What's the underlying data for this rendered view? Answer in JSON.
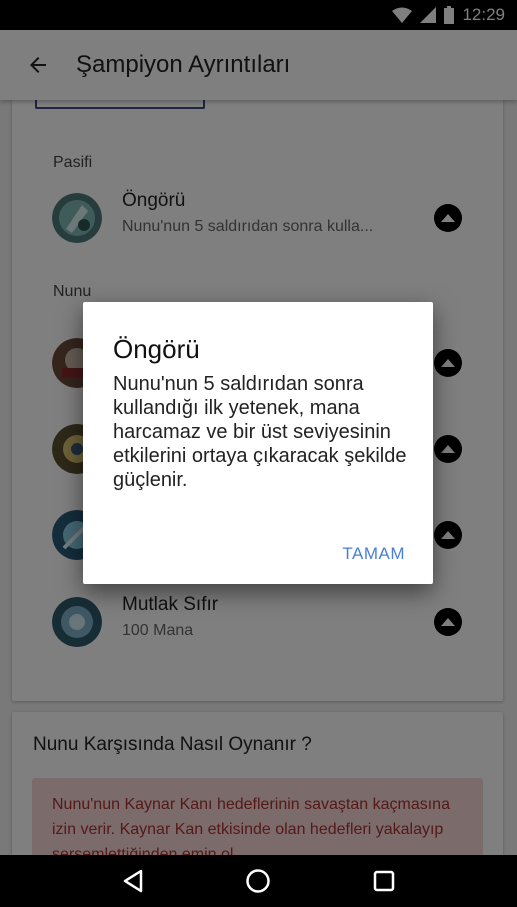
{
  "status_bar": {
    "time": "12:29"
  },
  "app_bar": {
    "title": "Şampiyon Ayrıntıları"
  },
  "passive": {
    "section_label": "Pasifi",
    "name": "Öngörü",
    "description": "Nunu'nun 5 saldırıdan sonra kulla..."
  },
  "abilities_section_label": "Nunu",
  "ultimate": {
    "name": "Mutlak Sıfır",
    "cost": "100 Mana"
  },
  "counter": {
    "title": "Nunu Karşısında Nasıl Oynanır ?",
    "tip": "Nunu'nun Kaynar Kanı hedeflerinin savaştan kaçmasına izin verir. Kaynar Kan etkisinde olan hedefleri yakalayıp sersemlettiğinden emin ol."
  },
  "dialog": {
    "title": "Öngörü",
    "body": "Nunu'nun 5 saldırıdan sonra kullandığı ilk yetenek, mana harcamaz ve bir üst seviyesinin etkilerini ortaya çıkaracak şekilde güçlenir.",
    "button": "TAMAM"
  },
  "icons": {
    "back": "arrow-left-icon",
    "wifi": "wifi-icon",
    "signal": "signal-icon",
    "battery": "battery-icon",
    "nav_back": "triangle-back-icon",
    "nav_home": "circle-home-icon",
    "nav_recents": "square-recents-icon",
    "expand": "chevron-up-icon"
  },
  "colors": {
    "accent": "#4a7fd6",
    "tip_bg": "#f7d6d6",
    "tip_text": "#aa3333"
  }
}
